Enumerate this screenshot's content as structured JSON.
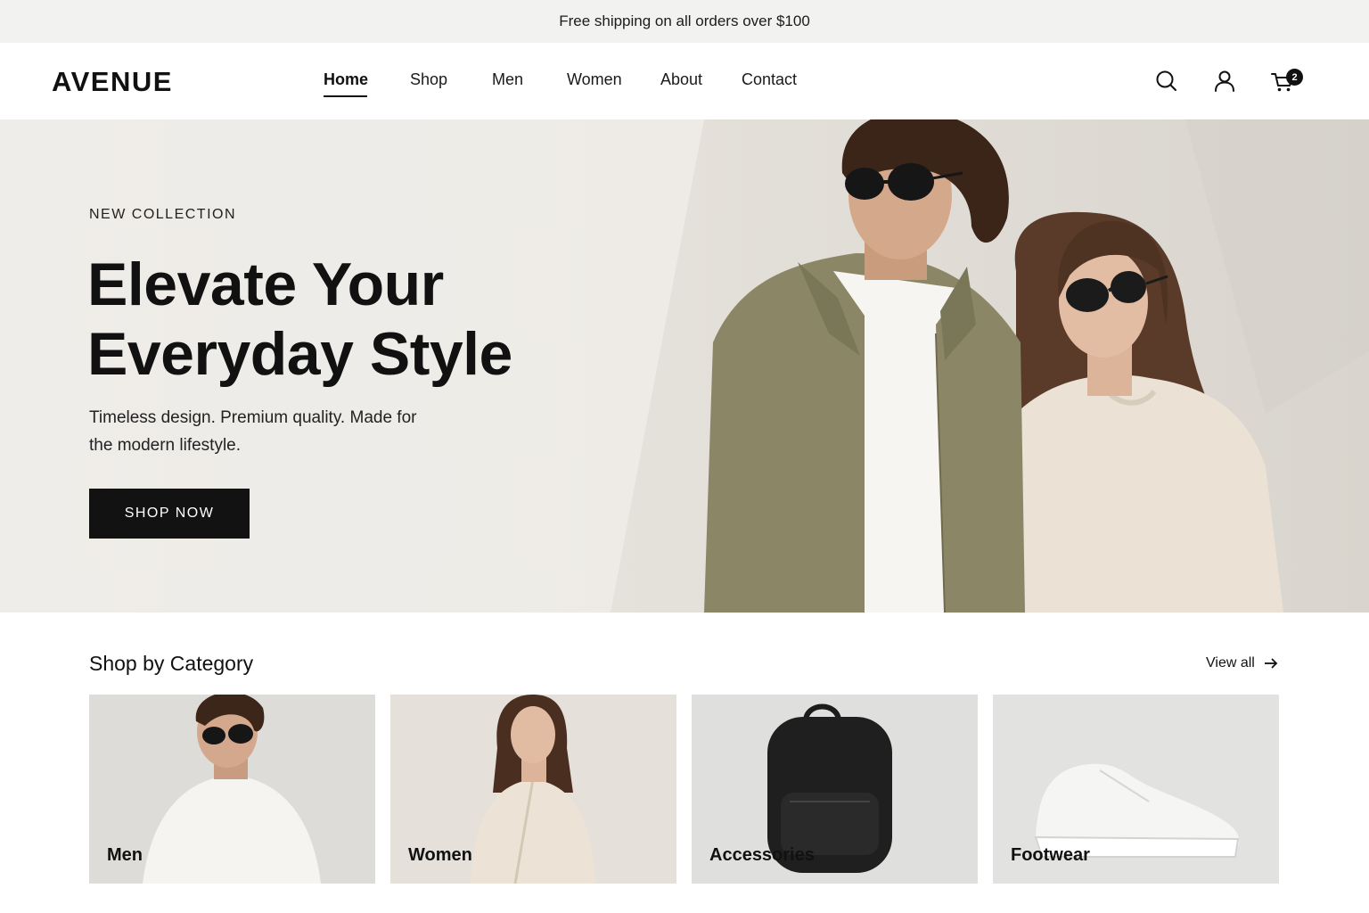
{
  "announcement": {
    "text": "Free shipping on all orders over $100"
  },
  "header": {
    "logo": "AVENUE",
    "nav": [
      "Home",
      "Shop",
      "Men",
      "Women",
      "About",
      "Contact"
    ],
    "active_nav": "Home",
    "icons": [
      "search-icon",
      "user-icon",
      "cart-icon"
    ],
    "cart_count": "2"
  },
  "hero": {
    "eyebrow": "NEW COLLECTION",
    "title_line1": "Elevate Your",
    "title_line2": "Everyday Style",
    "subtitle": "Timeless design. Premium quality. Made for the modern lifestyle.",
    "cta": "SHOP NOW"
  },
  "categories": {
    "title": "Shop by Category",
    "view_all": "View all",
    "items": [
      {
        "label": "Men"
      },
      {
        "label": "Women"
      },
      {
        "label": "Accessories"
      },
      {
        "label": "Footwear"
      }
    ]
  },
  "colors": {
    "accent": "#111111",
    "announcement_bg": "#f2f2f1",
    "hero_bg": "#efede9"
  }
}
